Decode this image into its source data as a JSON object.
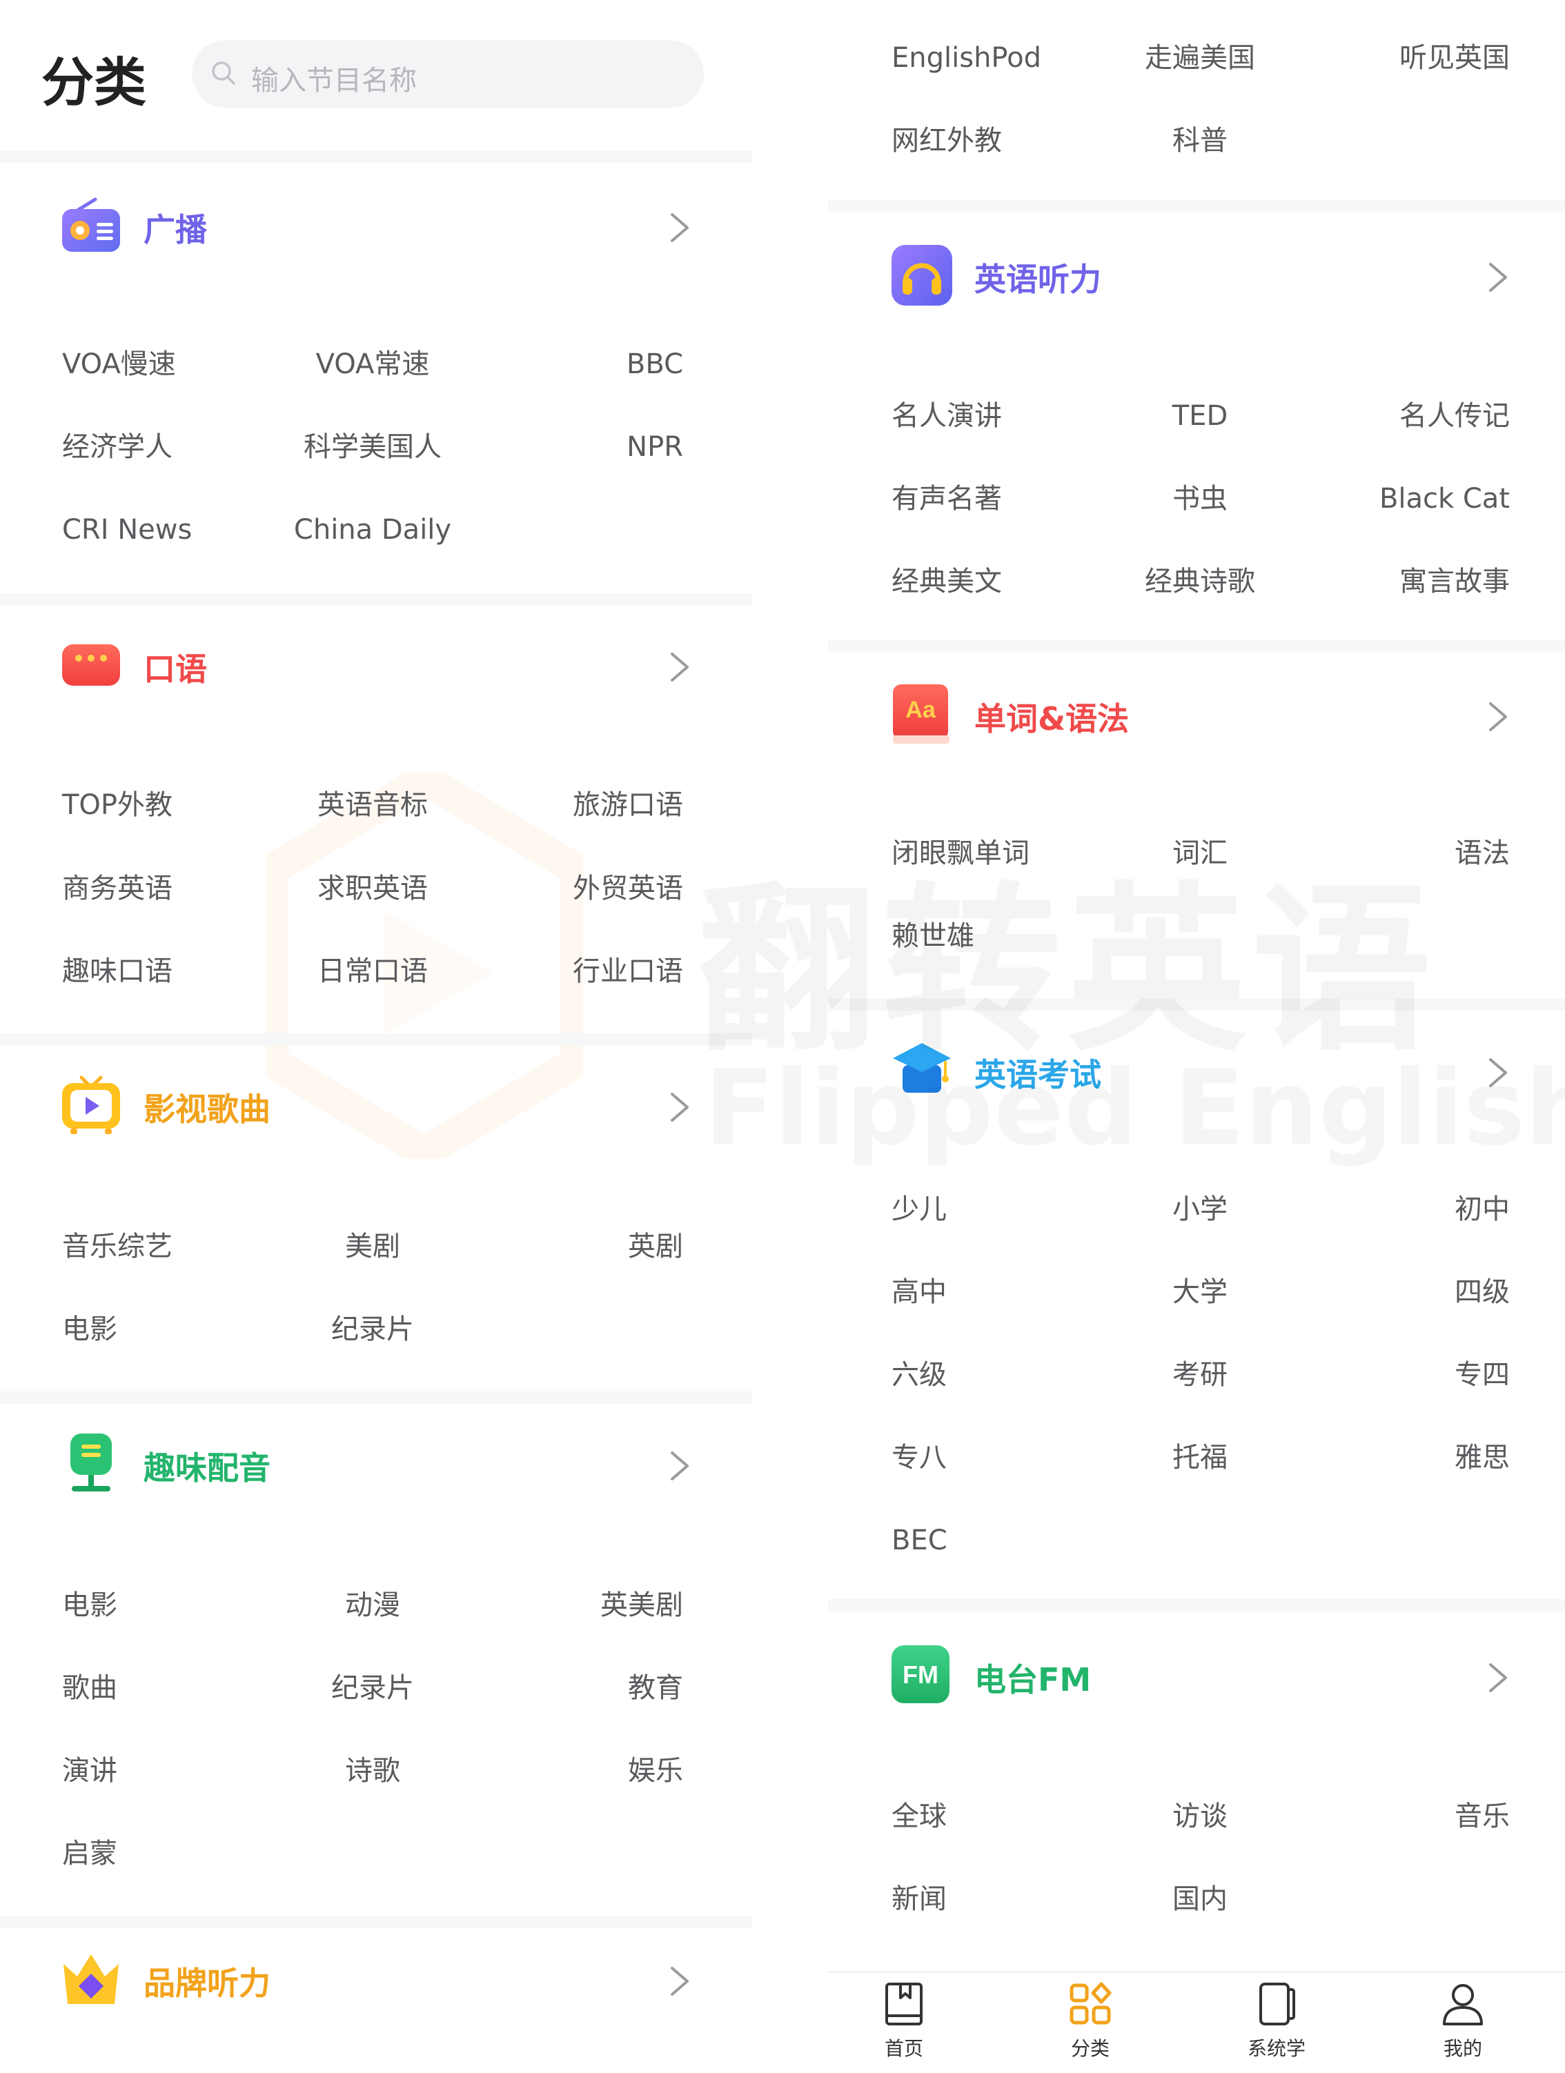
{
  "header": {
    "title": "分类",
    "search_placeholder": "输入节目名称"
  },
  "left_column": {
    "sections": [
      {
        "title": "广播",
        "title_color": "#6f63e8",
        "icon": "radio-icon",
        "items": [
          [
            "VOA慢速",
            "VOA常速",
            "BBC"
          ],
          [
            "经济学人",
            "科学美国人",
            "NPR"
          ],
          [
            "CRI News",
            "China Daily"
          ]
        ]
      },
      {
        "title": "口语",
        "title_color": "#f04a4a",
        "icon": "chat-bubble-icon",
        "items": [
          [
            "TOP外教",
            "英语音标",
            "旅游口语"
          ],
          [
            "商务英语",
            "求职英语",
            "外贸英语"
          ],
          [
            "趣味口语",
            "日常口语",
            "行业口语"
          ]
        ]
      },
      {
        "title": "影视歌曲",
        "title_color": "#f2a21b",
        "icon": "tv-play-icon",
        "items": [
          [
            "音乐综艺",
            "美剧",
            "英剧"
          ],
          [
            "电影",
            "纪录片"
          ]
        ]
      },
      {
        "title": "趣味配音",
        "title_color": "#23b46c",
        "icon": "microphone-icon",
        "items": [
          [
            "电影",
            "动漫",
            "英美剧"
          ],
          [
            "歌曲",
            "纪录片",
            "教育"
          ],
          [
            "演讲",
            "诗歌",
            "娱乐"
          ],
          [
            "启蒙"
          ]
        ]
      },
      {
        "title": "品牌听力",
        "title_color": "#f2a21b",
        "icon": "crown-diamond-icon",
        "items": []
      }
    ]
  },
  "right_column": {
    "top_items": [
      [
        "EnglishPod",
        "走遍美国",
        "听见英国"
      ],
      [
        "网红外教",
        "科普"
      ]
    ],
    "sections": [
      {
        "title": "英语听力",
        "title_color": "#6f63e8",
        "icon": "headphones-icon",
        "items": [
          [
            "名人演讲",
            "TED",
            "名人传记"
          ],
          [
            "有声名著",
            "书虫",
            "Black Cat"
          ],
          [
            "经典美文",
            "经典诗歌",
            "寓言故事"
          ]
        ]
      },
      {
        "title": "单词&语法",
        "title_color": "#f04a4a",
        "icon": "book-aa-icon",
        "icon_text": "Aa",
        "items": [
          [
            "闭眼飘单词",
            "词汇",
            "语法"
          ],
          [
            "赖世雄"
          ]
        ]
      },
      {
        "title": "英语考试",
        "title_color": "#2ba6e8",
        "icon": "graduation-cap-icon",
        "items": [
          [
            "少儿",
            "小学",
            "初中"
          ],
          [
            "高中",
            "大学",
            "四级"
          ],
          [
            "六级",
            "考研",
            "专四"
          ],
          [
            "专八",
            "托福",
            "雅思"
          ],
          [
            "BEC"
          ]
        ]
      },
      {
        "title": "电台FM",
        "title_color": "#23b46c",
        "icon": "fm-icon",
        "icon_text": "FM",
        "items": [
          [
            "全球",
            "访谈",
            "音乐"
          ],
          [
            "新闻",
            "国内"
          ]
        ]
      }
    ]
  },
  "watermark": {
    "cn": "翻转英语",
    "en": "Flipped English"
  },
  "bottom_nav": {
    "items": [
      {
        "label": "首页",
        "icon": "book-home-icon"
      },
      {
        "label": "分类",
        "icon": "category-grid-icon"
      },
      {
        "label": "系统学",
        "icon": "tablet-icon"
      },
      {
        "label": "我的",
        "icon": "user-icon"
      }
    ]
  },
  "colors": {
    "purple": "#6f63e8",
    "red": "#f04a4a",
    "orange": "#f2a21b",
    "green": "#23b46c",
    "blue": "#2ba6e8"
  }
}
